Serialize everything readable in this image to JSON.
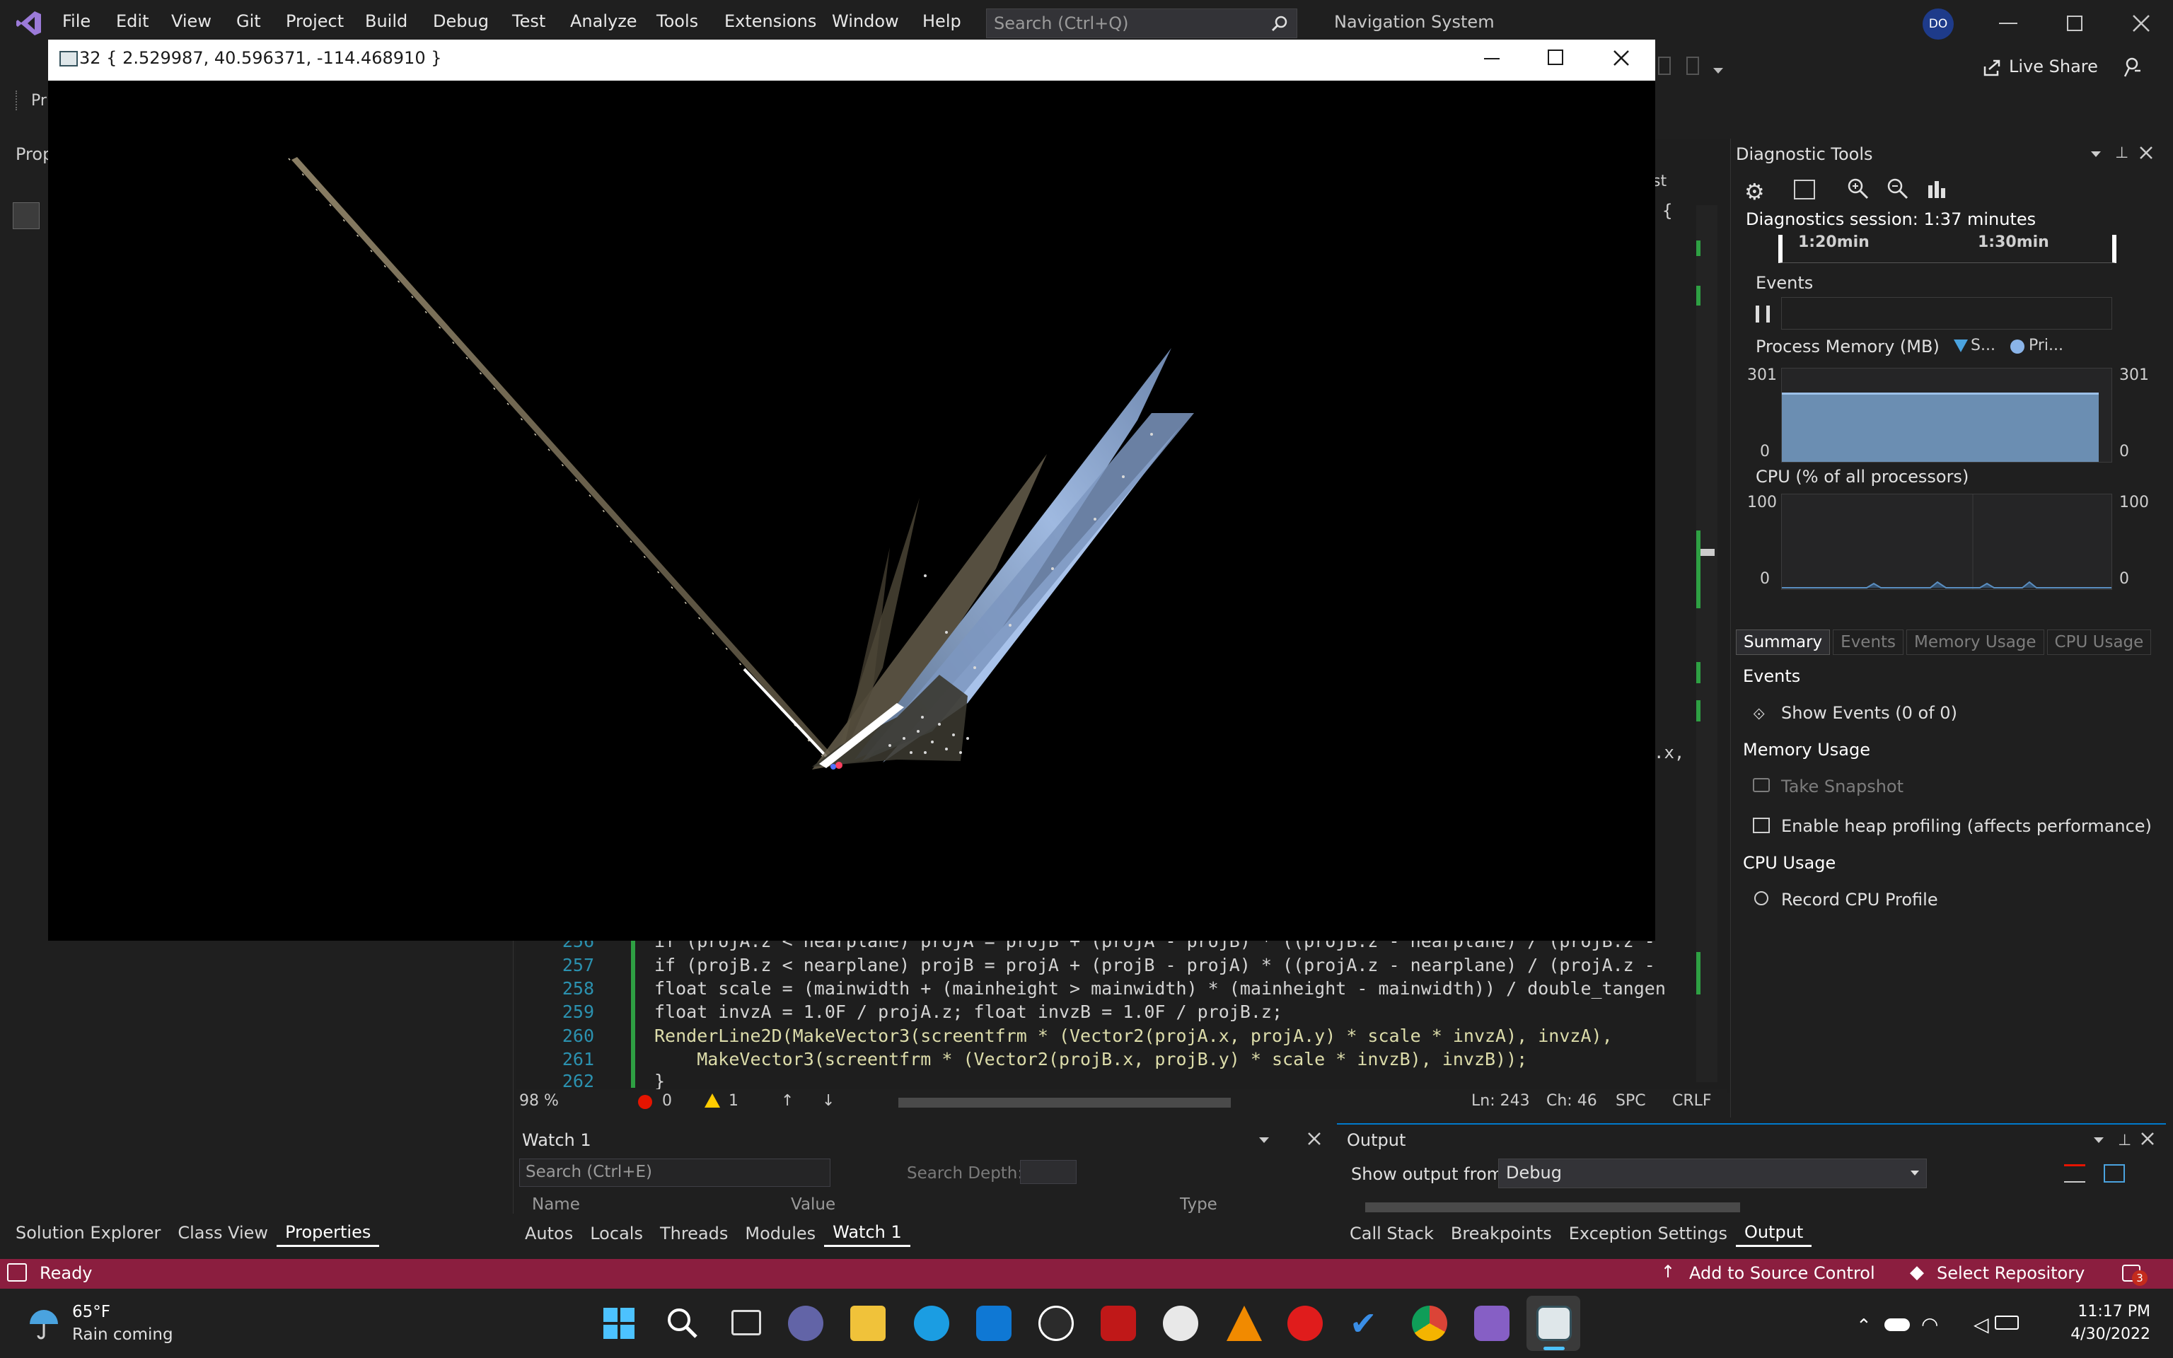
{
  "menu": {
    "items": [
      "File",
      "Edit",
      "View",
      "Git",
      "Project",
      "Build",
      "Debug",
      "Test",
      "Analyze",
      "Tools",
      "Extensions",
      "Window",
      "Help"
    ],
    "search_placeholder": "Search (Ctrl+Q)",
    "solution_title": "Navigation System",
    "avatar_initials": "DO"
  },
  "toolbar": {
    "live_share": "Live Share"
  },
  "left_panel": {
    "title": "Prop",
    "tabs": [
      "Solution Explorer",
      "Class View",
      "Properties"
    ],
    "active_tab": "Properties"
  },
  "render_window": {
    "title": "32 { 2.529987, 40.596371, -114.468910 }"
  },
  "editor": {
    "lines": [
      {
        "num": "256",
        "text": "if (projA.z < nearplane) projA = projB + (projA - projB) * ((projB.z - nearplane) / (projB.z -"
      },
      {
        "num": "257",
        "text": "if (projB.z < nearplane) projB = projA + (projB - projA) * ((projA.z - nearplane) / (projA.z -"
      },
      {
        "num": "258",
        "text": "float scale = (mainwidth + (mainheight > mainwidth) * (mainheight - mainwidth)) / double_tangen"
      },
      {
        "num": "259",
        "text": "float invzA = 1.0F / projA.z; float invzB = 1.0F / projB.z;"
      },
      {
        "num": "260",
        "text": "RenderLine2D(MakeVector3(screentfrm * (Vector2(projA.x, projA.y) * scale * invzA), invzA),"
      },
      {
        "num": "261",
        "text": "    MakeVector3(screentfrm * (Vector2(projB.x, projB.y) * scale * invzB), invzB));"
      },
      {
        "num": "262",
        "text": "}"
      }
    ],
    "side_fragment": ".x,",
    "side_brace": "{",
    "side_tab": "st",
    "status": {
      "zoom": "98 %",
      "errors": "0",
      "warnings": "1",
      "line": "Ln: 243",
      "col": "Ch: 46",
      "spc": "SPC",
      "crlf": "CRLF"
    }
  },
  "watch": {
    "title": "Watch 1",
    "search_placeholder": "Search (Ctrl+E)",
    "search_depth": "Search Depth:",
    "columns": [
      "Name",
      "Value",
      "Type"
    ],
    "tabs": [
      "Autos",
      "Locals",
      "Threads",
      "Modules",
      "Watch 1"
    ],
    "active_tab": "Watch 1"
  },
  "output": {
    "title": "Output",
    "show_from_label": "Show output from:",
    "show_from_value": "Debug",
    "tabs": [
      "Call Stack",
      "Breakpoints",
      "Exception Settings",
      "Output"
    ],
    "active_tab": "Output"
  },
  "diagnostics": {
    "title": "Diagnostic Tools",
    "session": "Diagnostics session: 1:37 minutes",
    "timeline": [
      "1:20min",
      "1:30min"
    ],
    "events_header": "Events",
    "memory_header": "Process Memory (MB)",
    "memory_legend": [
      "S...",
      "Pri..."
    ],
    "memory_max": "301",
    "memory_min": "0",
    "cpu_header": "CPU (% of all processors)",
    "cpu_max": "100",
    "cpu_min": "0",
    "tabs": [
      "Summary",
      "Events",
      "Memory Usage",
      "CPU Usage"
    ],
    "active_tab": "Summary",
    "sections": {
      "events": "Events",
      "show_events": "Show Events (0 of 0)",
      "memory_usage": "Memory Usage",
      "take_snapshot": "Take Snapshot",
      "heap_profiling": "Enable heap profiling (affects performance)",
      "cpu_usage": "CPU Usage",
      "record_cpu": "Record CPU Profile"
    }
  },
  "statusbar": {
    "ready": "Ready",
    "add_source_control": "Add to Source Control",
    "select_repository": "Select Repository",
    "notifications": "3"
  },
  "taskbar": {
    "weather_temp": "65°F",
    "weather_desc": "Rain coming",
    "time": "11:17 PM",
    "date": "4/30/2022"
  },
  "colors": {
    "accent": "#007acc",
    "statusbar": "#8b1e3f",
    "vs_purple": "#865fc5"
  }
}
